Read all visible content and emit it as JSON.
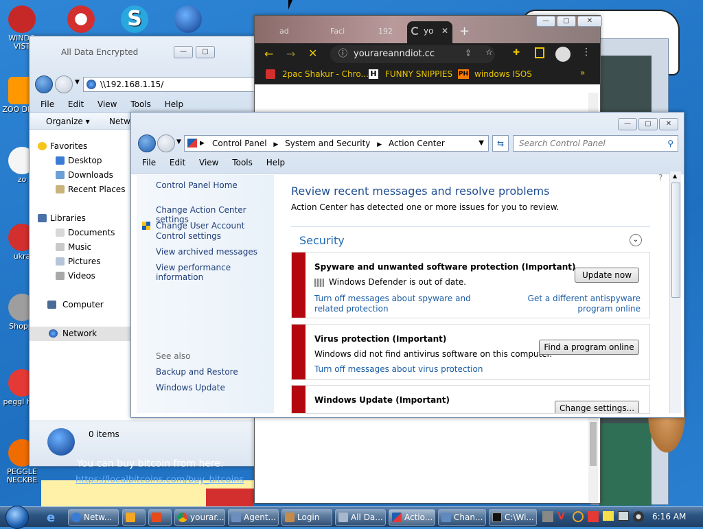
{
  "desktop_icons": [
    {
      "label": "WINDO VIST",
      "color": "#c62828"
    },
    {
      "label": "",
      "color": "#d32f2f"
    },
    {
      "label": "",
      "color": "#1e88e5"
    },
    {
      "label": "",
      "color": "#1565c0"
    },
    {
      "label": "ZOO DELU",
      "color": "#ff9800"
    },
    {
      "label": "zo",
      "color": "#f4f4f4"
    },
    {
      "label": "ukra",
      "color": "#d32f2f"
    },
    {
      "label": "Shoppi",
      "color": "#9e9e9e"
    },
    {
      "label": "peggl heg",
      "color": "#e53935"
    },
    {
      "label": "PEGGLE NECKBE",
      "color": "#ef6c00"
    }
  ],
  "explorer": {
    "title": "All Data Encrypted",
    "address": "\\\\192.168.1.15/",
    "menu": [
      "File",
      "Edit",
      "View",
      "Tools",
      "Help"
    ],
    "organize": "Organize",
    "network": "Netwo",
    "favorites_header": "Favorites",
    "favorites": [
      "Desktop",
      "Downloads",
      "Recent Places"
    ],
    "libraries_header": "Libraries",
    "libraries": [
      "Documents",
      "Music",
      "Pictures",
      "Videos"
    ],
    "computer": "Computer",
    "network_item": "Network",
    "status": "0 items",
    "bg_text": "You can buy bitcoin from here:",
    "bg_link": "https://localbitcoins.com/buy_bitcoins"
  },
  "chrome": {
    "tabs": [
      "ad",
      "Faci",
      "192",
      "yo"
    ],
    "url": "yourareanndiot.cc",
    "bookmarks": [
      "2pac Shakur - Chro...",
      "FUNNY SNIPPIES",
      "windows ISOS"
    ],
    "bm_more": "»"
  },
  "action_center": {
    "breadcrumb": [
      "Control Panel",
      "System and Security",
      "Action Center"
    ],
    "search_placeholder": "Search Control Panel",
    "menu": [
      "File",
      "Edit",
      "View",
      "Tools",
      "Help"
    ],
    "left_links": [
      "Control Panel Home",
      "Change Action Center settings",
      "Change User Account Control settings",
      "View archived messages",
      "View performance information"
    ],
    "see_also": "See also",
    "see_also_links": [
      "Backup and Restore",
      "Windows Update"
    ],
    "heading": "Review recent messages and resolve problems",
    "subheading": "Action Center has detected one or more issues for you to review.",
    "section": "Security",
    "items": [
      {
        "title": "Spyware and unwanted software protection  (Important)",
        "desc": "Windows Defender is out of date.",
        "button": "Update now",
        "link1": "Turn off messages about spyware and related protection",
        "link2": "Get a different antispyware program online"
      },
      {
        "title": "Virus protection  (Important)",
        "desc": "Windows did not find antivirus software on this computer.",
        "button": "Find a program online",
        "link1": "Turn off messages about virus protection"
      },
      {
        "title": "Windows Update  (Important)",
        "button": "Change settings..."
      }
    ]
  },
  "taskbar": {
    "tasks": [
      "Netw...",
      "",
      "",
      "yourar...",
      "Agent...",
      "Login",
      "All Da...",
      "Actio...",
      "Chan...",
      "C:\\Wi..."
    ],
    "clock": "6:16 AM"
  },
  "colors": {
    "important": "#b3060e",
    "link": "#1a5da6",
    "heading": "#1f4e91"
  }
}
